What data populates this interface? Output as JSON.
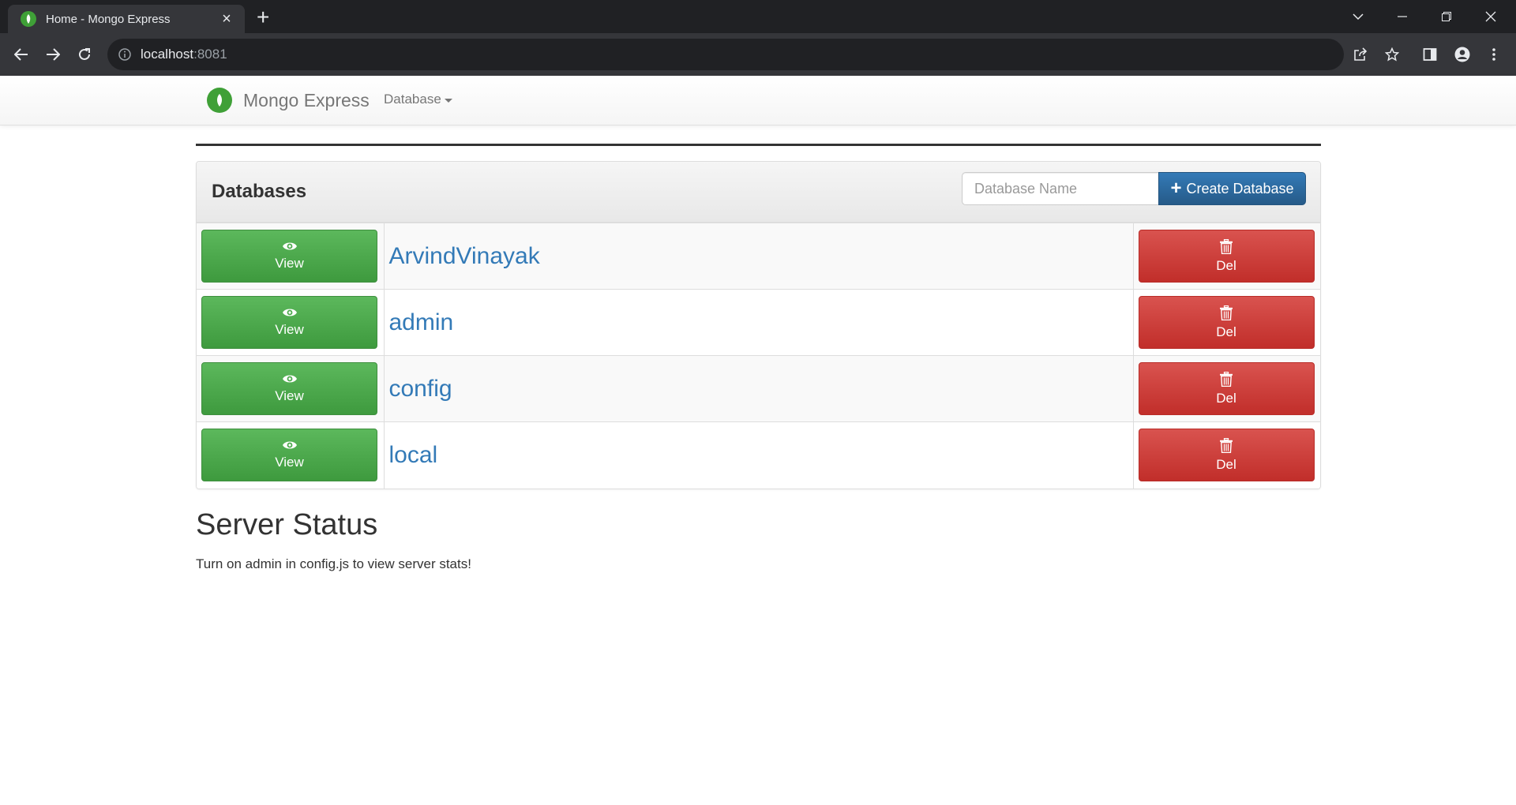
{
  "browser": {
    "tab_title": "Home - Mongo Express",
    "url_host": "localhost",
    "url_port": ":8081"
  },
  "navbar": {
    "brand": "Mongo Express",
    "menu": "Database"
  },
  "databases": {
    "title": "Databases",
    "input_placeholder": "Database Name",
    "create_label": "Create Database",
    "view_label": "View",
    "del_label": "Del",
    "rows": [
      {
        "name": "ArvindVinayak"
      },
      {
        "name": "admin"
      },
      {
        "name": "config"
      },
      {
        "name": "local"
      }
    ]
  },
  "server_status": {
    "title": "Server Status",
    "message": "Turn on admin in config.js to view server stats!"
  },
  "colors": {
    "mongo_green": "#3fa037",
    "view_green": "#5cb85c",
    "del_red": "#d9534f",
    "link_blue": "#337ab7"
  }
}
